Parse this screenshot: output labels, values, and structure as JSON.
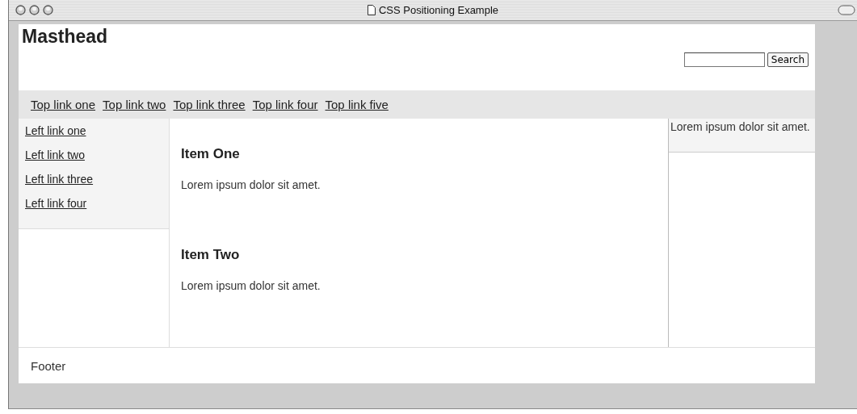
{
  "window": {
    "title": "CSS Positioning Example"
  },
  "masthead": {
    "title": "Masthead",
    "search_button": "Search"
  },
  "top_links": [
    "Top link one",
    "Top link two",
    "Top link three",
    "Top link four",
    "Top link five"
  ],
  "left_links": [
    "Left link one",
    "Left link two",
    "Left link three",
    "Left link four"
  ],
  "items": [
    {
      "heading": "Item One",
      "text": "Lorem ipsum dolor sit amet."
    },
    {
      "heading": "Item Two",
      "text": "Lorem ipsum dolor sit amet."
    }
  ],
  "sidebar": {
    "text": "Lorem ipsum dolor sit amet."
  },
  "footer": "Footer"
}
